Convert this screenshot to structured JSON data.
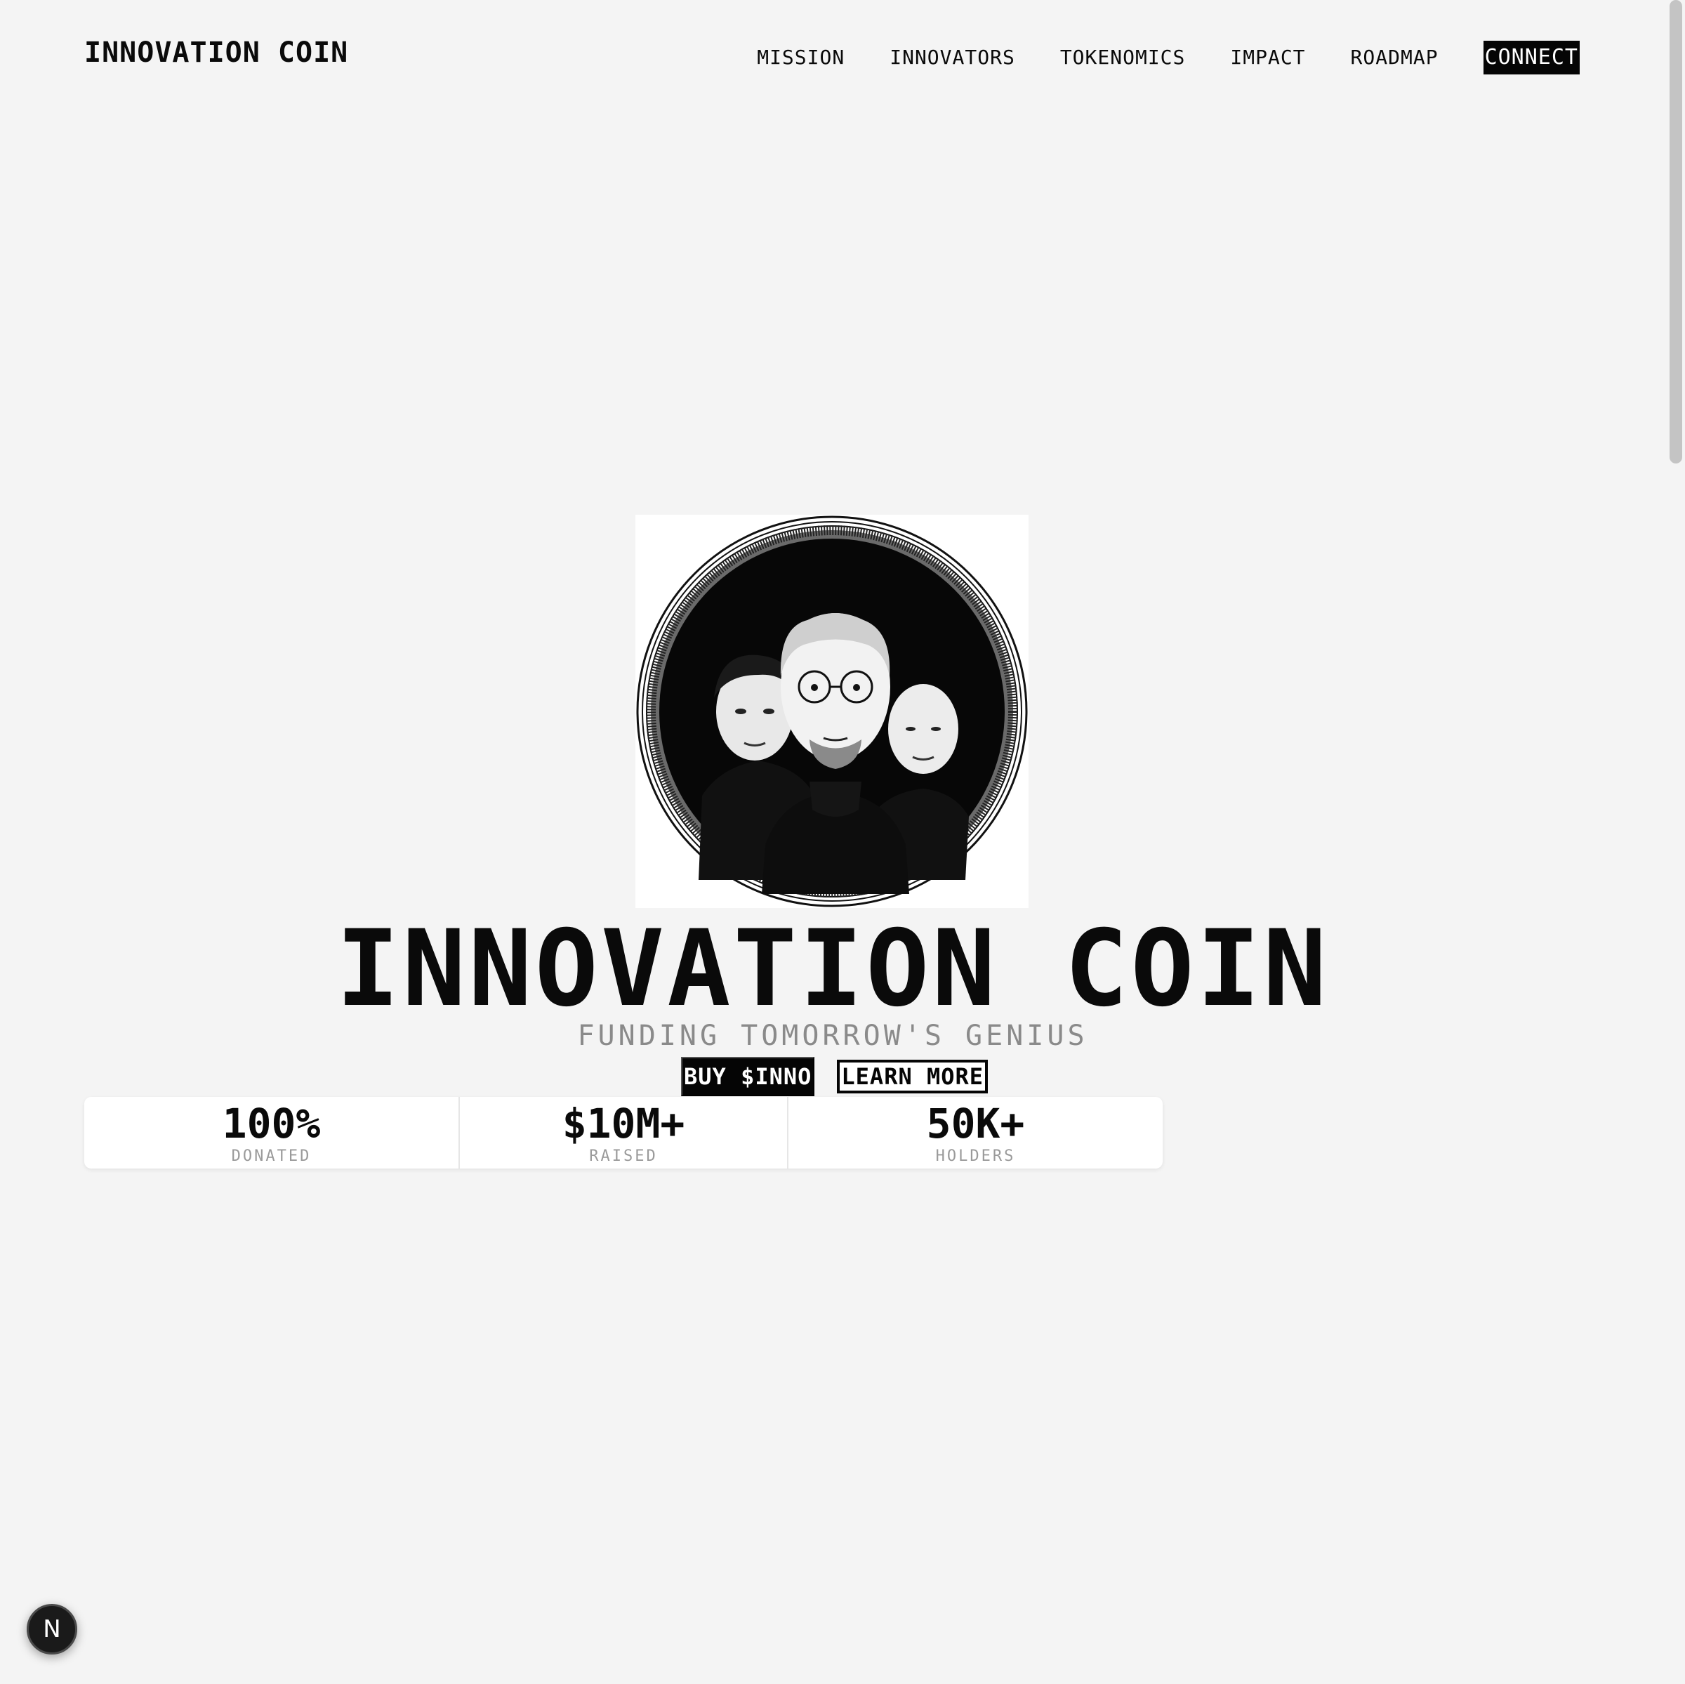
{
  "header": {
    "logo": "INNOVATION COIN",
    "nav": [
      "MISSION",
      "INNOVATORS",
      "TOKENOMICS",
      "IMPACT",
      "ROADMAP"
    ],
    "connect_label": "CONNECT"
  },
  "hero": {
    "image_icon": "coin-portrait-illustration",
    "title": "INNOVATION COIN",
    "subtitle": "FUNDING TOMORROW'S GENIUS",
    "buy_label": "BUY $INNO",
    "learn_label": "LEARN MORE"
  },
  "stats": [
    {
      "value": "100%",
      "label": "DONATED"
    },
    {
      "value": "$10M+",
      "label": "RAISED"
    },
    {
      "value": "50K+",
      "label": "HOLDERS"
    }
  ],
  "dev_badge": {
    "letter": "N"
  },
  "colors": {
    "background": "#f4f4f4",
    "primary": "#050505",
    "muted": "#8a8a8a",
    "card": "#ffffff"
  }
}
